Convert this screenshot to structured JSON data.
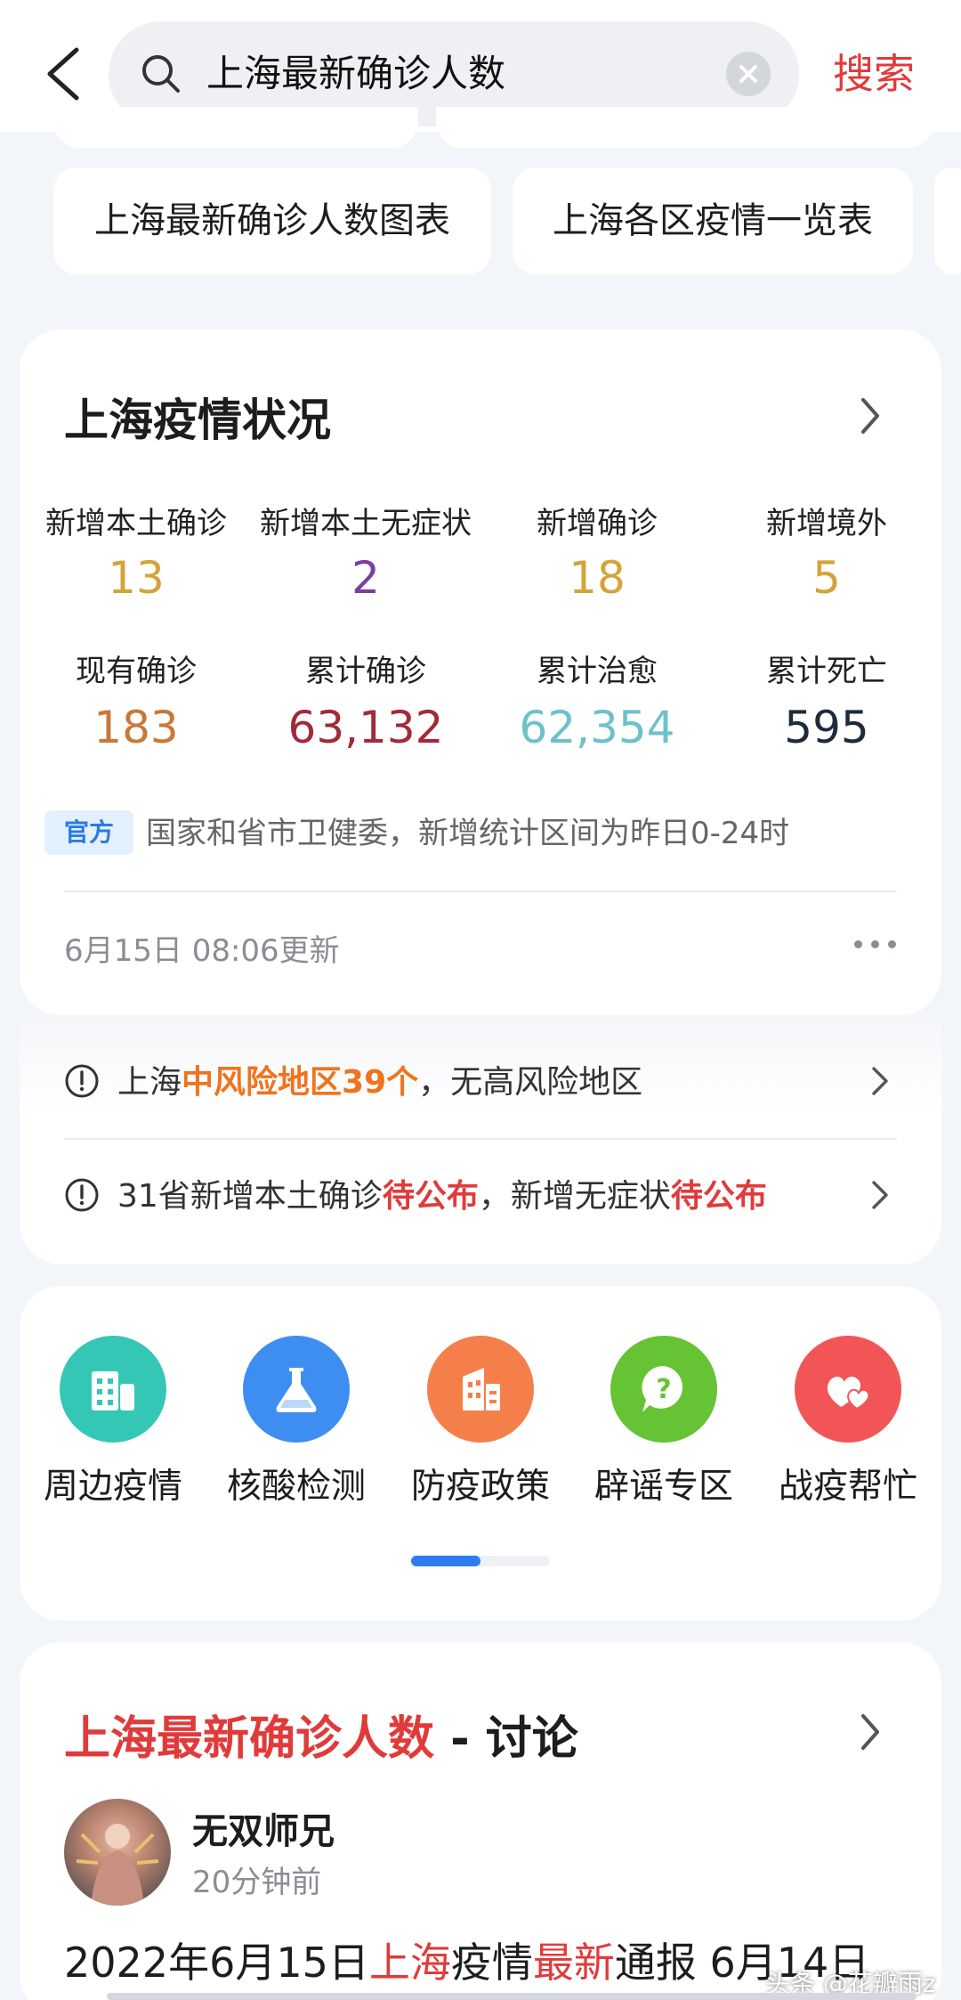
{
  "search": {
    "query": "上海最新确诊人数",
    "button_label": "搜索"
  },
  "suggestions": [
    {
      "label": "上海最新确诊人数图表"
    },
    {
      "label": "上海各区疫情一览表"
    }
  ],
  "status_card": {
    "title": "上海疫情状况",
    "stats_row1": [
      {
        "label": "新增本土确诊",
        "value": "13",
        "color": "#d4a43a"
      },
      {
        "label": "新增本土无症状",
        "value": "2",
        "color": "#7a3fa0"
      },
      {
        "label": "新增确诊",
        "value": "18",
        "color": "#d4a43a"
      },
      {
        "label": "新增境外",
        "value": "5",
        "color": "#d4a43a"
      }
    ],
    "stats_row2": [
      {
        "label": "现有确诊",
        "value": "183",
        "color": "#c8783a"
      },
      {
        "label": "累计确诊",
        "value": "63,132",
        "color": "#a32a3a"
      },
      {
        "label": "累计治愈",
        "value": "62,354",
        "color": "#6cc2c8"
      },
      {
        "label": "累计死亡",
        "value": "595",
        "color": "#1d2b3a"
      }
    ],
    "source_badge": "官方",
    "source_text": "国家和省市卫健委，新增统计区间为昨日0-24时",
    "updated": "6月15日 08:06更新"
  },
  "notices": [
    {
      "prefix": "上海",
      "highlight": "中风险地区39个",
      "middle": "，无高风险地区",
      "highlight2": "",
      "suffix": ""
    },
    {
      "prefix": "31省新增本土确诊",
      "highlight": "待公布",
      "middle": "，新增无症状",
      "highlight2": "待公布",
      "suffix": ""
    }
  ],
  "services": [
    {
      "label": "周边疫情",
      "icon": "building-icon",
      "color": "#35c7b6"
    },
    {
      "label": "核酸检测",
      "icon": "flask-icon",
      "color": "#3d8ef0"
    },
    {
      "label": "防疫政策",
      "icon": "office-icon",
      "color": "#f57f4a"
    },
    {
      "label": "辟谣专区",
      "icon": "question-bubble-icon",
      "color": "#66c334"
    },
    {
      "label": "战疫帮忙",
      "icon": "hearts-icon",
      "color": "#f25555"
    }
  ],
  "discussion": {
    "title_highlight": "上海最新确诊人数",
    "title_suffix": " - 讨论",
    "author": "无双师兄",
    "time_ago": "20分钟前",
    "post_parts": [
      "2022年6月15日",
      "上海",
      "疫情",
      "最新",
      "通报 6月14日"
    ]
  },
  "watermark": "头条 @花瓣雨z"
}
